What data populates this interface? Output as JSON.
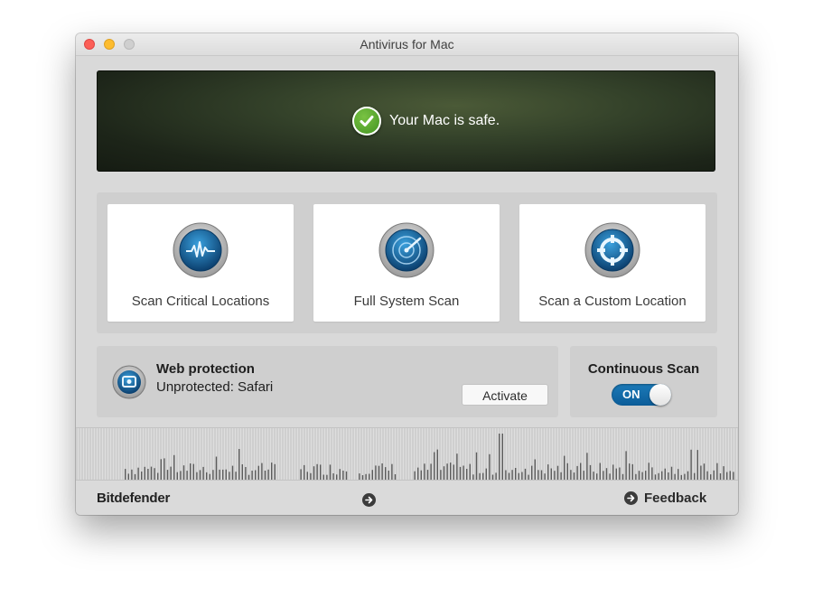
{
  "window": {
    "title": "Antivirus for Mac"
  },
  "banner": {
    "status": "Your Mac is safe.",
    "icon": "check-circle-icon"
  },
  "scan_cards": [
    {
      "label": "Scan Critical Locations",
      "icon": "waveform-icon"
    },
    {
      "label": "Full System Scan",
      "icon": "radar-icon"
    },
    {
      "label": "Scan a Custom Location",
      "icon": "target-icon"
    }
  ],
  "web_protection": {
    "title": "Web protection",
    "status": "Unprotected: Safari",
    "button": "Activate",
    "icon": "shield-globe-icon"
  },
  "continuous_scan": {
    "title": "Continuous Scan",
    "toggle_label": "ON",
    "enabled": true
  },
  "footer": {
    "brand": "Bitdefender",
    "feedback": "Feedback"
  },
  "colors": {
    "accent": "#0e66a6",
    "safe_green": "#4a9f2b",
    "panel": "#cfcfcf",
    "background": "#d9d9d9"
  }
}
